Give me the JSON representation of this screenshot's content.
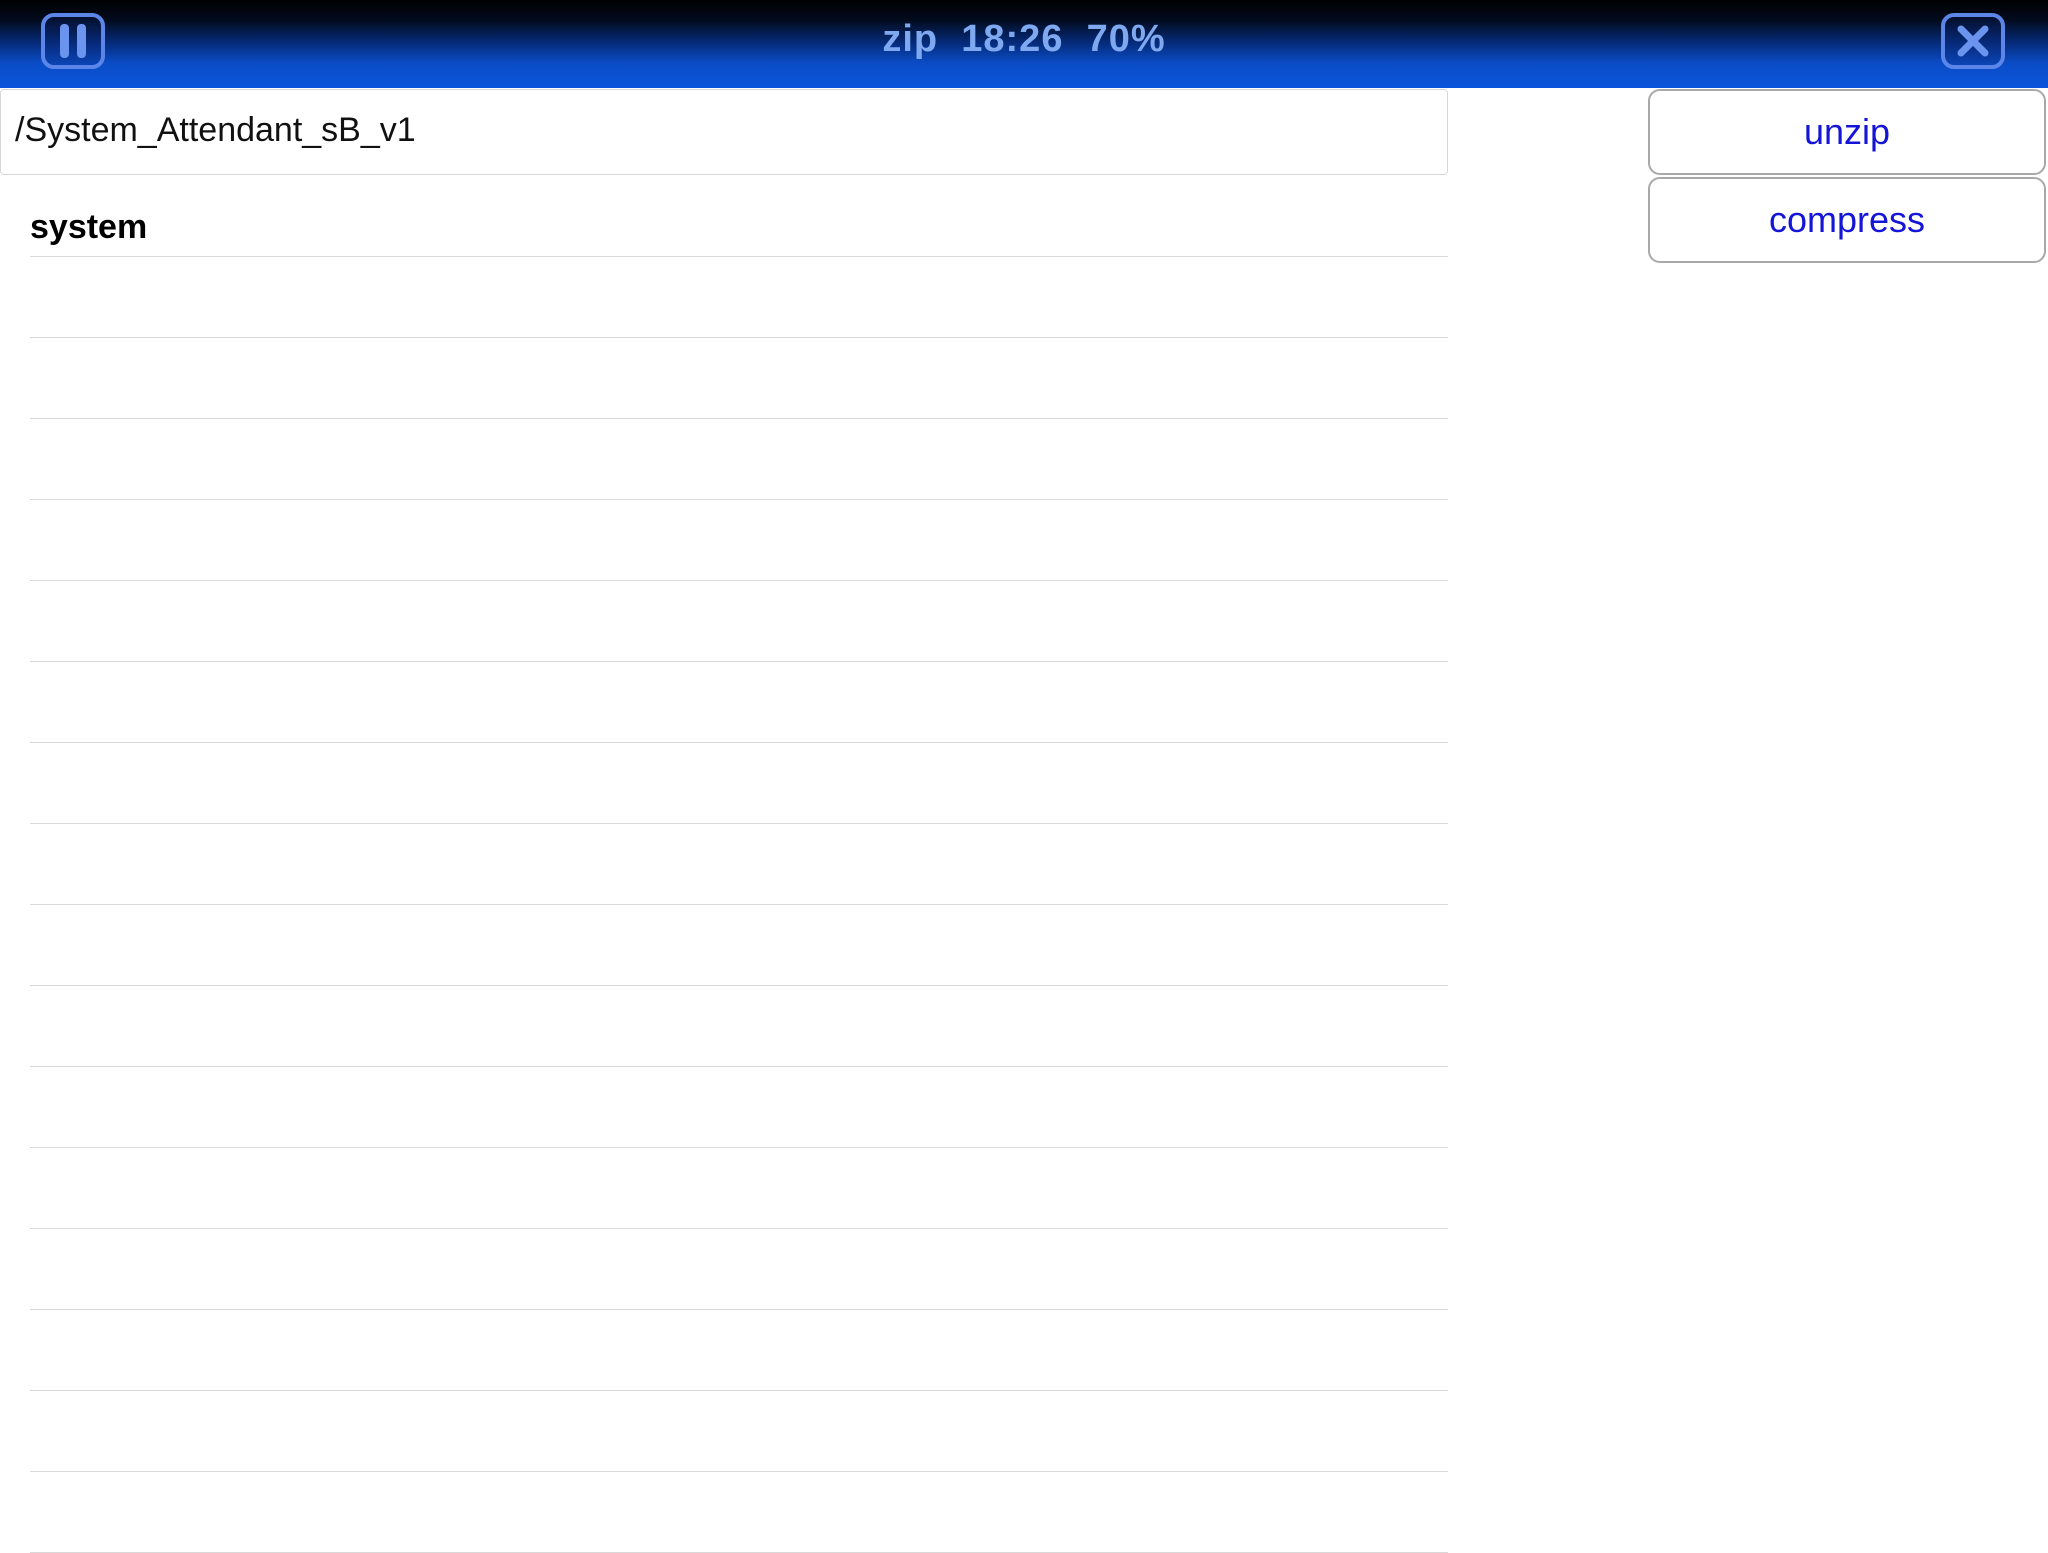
{
  "header": {
    "title": "zip  18:26  70%",
    "pause_icon": "pause-icon",
    "close_icon": "close-icon",
    "accent_color": "#5b86e8"
  },
  "path": {
    "value": "/System_Attendant_sB_v1"
  },
  "actions": {
    "unzip_label": "unzip",
    "compress_label": "compress",
    "label_color": "#1515d8"
  },
  "file_list": {
    "items": [
      {
        "label": "system"
      },
      {
        "label": ""
      },
      {
        "label": ""
      },
      {
        "label": ""
      },
      {
        "label": ""
      },
      {
        "label": ""
      },
      {
        "label": ""
      },
      {
        "label": ""
      },
      {
        "label": ""
      },
      {
        "label": ""
      },
      {
        "label": ""
      },
      {
        "label": ""
      },
      {
        "label": ""
      },
      {
        "label": ""
      },
      {
        "label": ""
      },
      {
        "label": ""
      },
      {
        "label": ""
      }
    ]
  }
}
